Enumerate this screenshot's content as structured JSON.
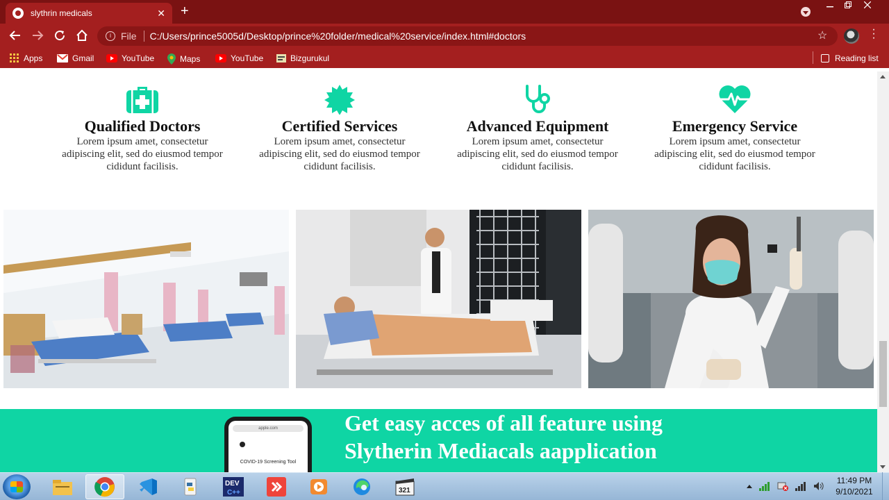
{
  "browser": {
    "tab_title": "slythrin medicals",
    "tab_close": "✕",
    "new_tab": "+",
    "url_file_label": "File",
    "url": "C:/Users/prince5005d/Desktop/prince%20folder/medical%20service/index.html#doctors",
    "bookmarks": [
      "Apps",
      "Gmail",
      "YouTube",
      "Maps",
      "YouTube",
      "Bizgurukul"
    ],
    "reading_list": "Reading list",
    "accent": "#a41f1f",
    "tabstrip_color": "#7a1212"
  },
  "features": [
    {
      "icon": "medical-kit-icon",
      "title": "Qualified Doctors",
      "text": "Lorem ipsum amet, consectetur adipiscing elit, sed do eiusmod tempor cididunt facilisis."
    },
    {
      "icon": "certificate-badge-icon",
      "title": "Certified Services",
      "text": "Lorem ipsum amet, consectetur adipiscing elit, sed do eiusmod tempor cididunt facilisis."
    },
    {
      "icon": "stethoscope-icon",
      "title": "Advanced Equipment",
      "text": "Lorem ipsum amet, consectetur adipiscing elit, sed do eiusmod tempor cididunt facilisis."
    },
    {
      "icon": "heartbeat-icon",
      "title": "Emergency Service",
      "text": "Lorem ipsum amet, consectetur adipiscing elit, sed do eiusmod tempor cididunt facilisis."
    }
  ],
  "feature_icon_color": "#0fd5a4",
  "gallery": [
    "hospital-ward-photo",
    "doctor-with-patient-photo",
    "lab-scientist-photo"
  ],
  "app_banner": {
    "line1": "Get easy acces of all feature using",
    "line2": "Slytherin Mediacals aapplication",
    "phone_screen_text": "COVID-19 Screening Tool",
    "phone_url": "apple.com",
    "color": "#0fd5a4"
  },
  "taskbar": {
    "time": "11:49 PM",
    "date": "9/10/2021",
    "apps": [
      "file-explorer",
      "chrome",
      "vscode",
      "python",
      "dev-cpp",
      "anydesk",
      "media-player",
      "edge",
      "media-player-classic"
    ]
  }
}
